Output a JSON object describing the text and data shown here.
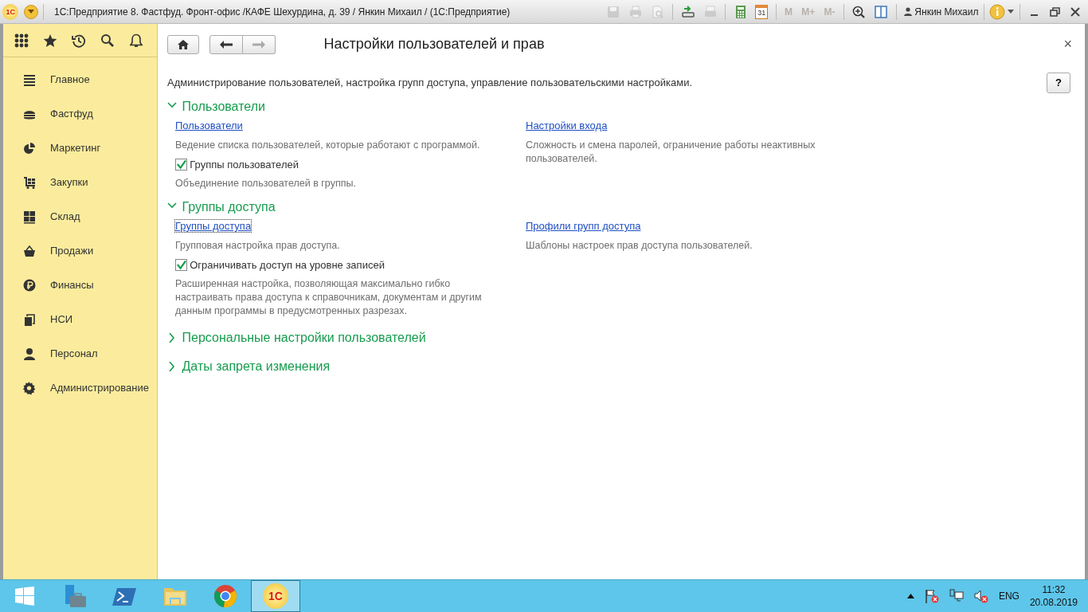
{
  "window": {
    "logo": "1С",
    "title": "1С:Предприятие 8. Фастфуд. Фронт-офис /КАФЕ Шехурдина, д. 39 / Янкин Михаил /  (1С:Предприятие)",
    "tools": [
      {
        "kind": "save",
        "disabled": true
      },
      {
        "kind": "print",
        "disabled": true
      },
      {
        "kind": "preview",
        "disabled": true
      },
      {
        "kind": "sep"
      },
      {
        "kind": "upload",
        "disabled": false
      },
      {
        "kind": "scan",
        "disabled": true
      },
      {
        "kind": "sep"
      },
      {
        "kind": "calculator",
        "disabled": false
      },
      {
        "kind": "calendar",
        "label": "31",
        "disabled": false
      },
      {
        "kind": "sep"
      },
      {
        "kind": "text",
        "label": "M",
        "disabled": true
      },
      {
        "kind": "text",
        "label": "M+",
        "disabled": true
      },
      {
        "kind": "text",
        "label": "M-",
        "disabled": true
      },
      {
        "kind": "sep"
      },
      {
        "kind": "zoom",
        "disabled": false
      },
      {
        "kind": "panel",
        "disabled": false
      },
      {
        "kind": "sep"
      }
    ],
    "user": "Янкин Михаил"
  },
  "sidebar": {
    "items": [
      {
        "label": "Главное"
      },
      {
        "label": "Фастфуд"
      },
      {
        "label": "Маркетинг"
      },
      {
        "label": "Закупки"
      },
      {
        "label": "Склад"
      },
      {
        "label": "Продажи"
      },
      {
        "label": "Финансы"
      },
      {
        "label": "НСИ"
      },
      {
        "label": "Персонал"
      },
      {
        "label": "Администрирование"
      }
    ]
  },
  "form": {
    "back_enabled": true,
    "forward_enabled": false,
    "title": "Настройки пользователей и прав",
    "close": "×",
    "help": "?",
    "description": "Администрирование пользователей, настройка групп доступа, управление пользовательскими настройками.",
    "groups": [
      {
        "title": "Пользователи",
        "expanded": true,
        "columns": [
          [
            {
              "kind": "link",
              "label": "Пользователи",
              "focused": false,
              "description": "Ведение списка пользователей, которые работают с программой."
            },
            {
              "kind": "checkbox",
              "label": "Группы пользователей",
              "checked": true,
              "description": "Объединение пользователей в группы."
            }
          ],
          [
            {
              "kind": "link",
              "label": "Настройки входа",
              "focused": false,
              "description": "Сложность и смена паролей, ограничение работы неактивных пользователей."
            }
          ]
        ]
      },
      {
        "title": "Группы доступа",
        "expanded": true,
        "columns": [
          [
            {
              "kind": "link",
              "label": "Группы доступа",
              "focused": true,
              "description": "Групповая настройка прав доступа."
            },
            {
              "kind": "checkbox",
              "label": "Ограничивать доступ на уровне записей",
              "checked": true,
              "description": "Расширенная настройка, позволяющая максимально гибко настраивать права доступа к справочникам, документам и другим данным программы в предусмотренных разрезах."
            }
          ],
          [
            {
              "kind": "link",
              "label": "Профили групп доступа",
              "focused": false,
              "description": "Шаблоны настроек прав доступа пользователей."
            }
          ]
        ]
      },
      {
        "title": "Персональные настройки пользователей",
        "expanded": false
      },
      {
        "title": "Даты запрета изменения",
        "expanded": false
      }
    ]
  },
  "taskbar": {
    "apps": [
      {
        "kind": "server",
        "selected": false
      },
      {
        "kind": "powershell",
        "selected": false
      },
      {
        "kind": "explorer",
        "selected": false
      },
      {
        "kind": "chrome",
        "selected": false
      },
      {
        "kind": "onec",
        "label": "1С",
        "selected": true
      }
    ],
    "language": "ENG",
    "time": "11:32",
    "date": "20.08.2019"
  }
}
